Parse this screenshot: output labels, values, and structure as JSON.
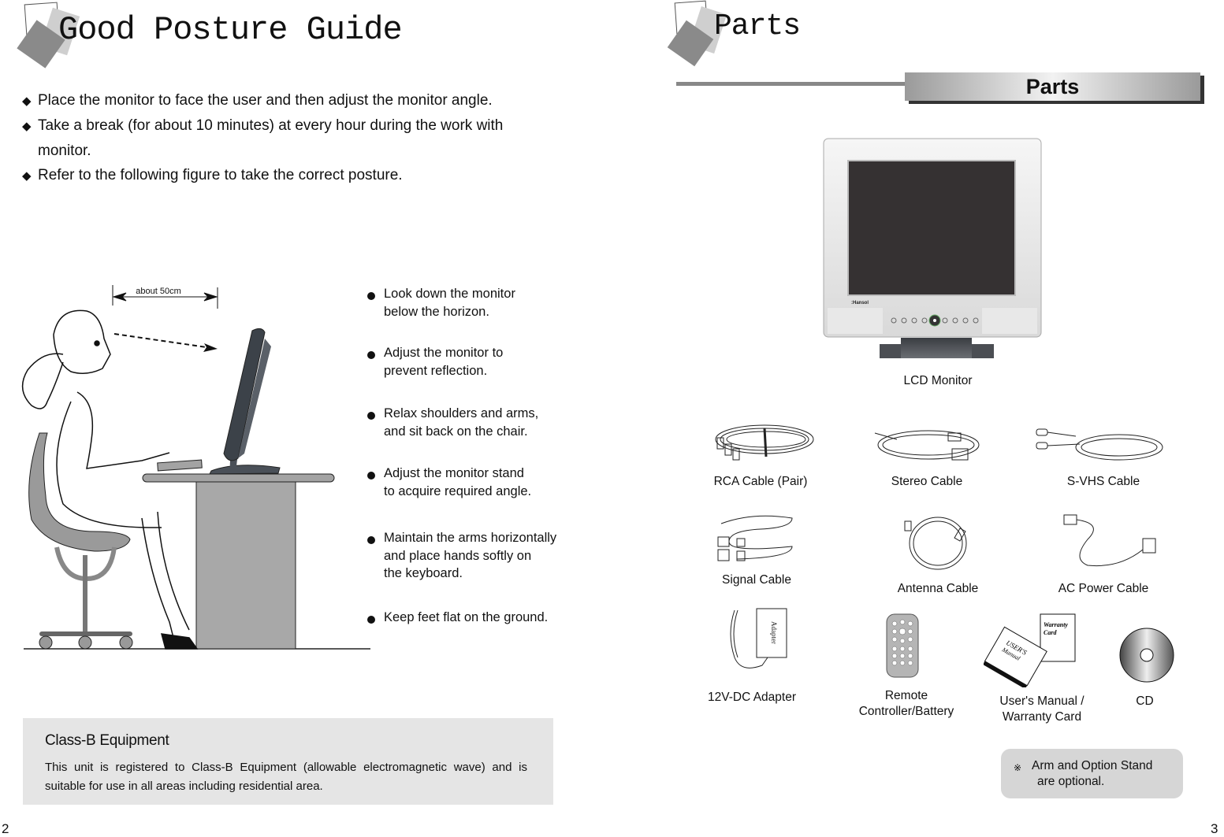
{
  "left_page": {
    "title": "Good Posture Guide",
    "bullets": [
      "Place the monitor to face the user and then adjust the monitor angle.",
      "Take a break (for about 10 minutes) at every hour during the work with",
      "monitor.",
      "Refer to the following figure to take the correct posture."
    ],
    "bullet_marker": "◆",
    "figure": {
      "distance_label": "about 50cm"
    },
    "tips": [
      [
        "Look down the monitor",
        "below the horizon."
      ],
      [
        "Adjust the monitor to",
        "prevent reflection."
      ],
      [
        "Relax shoulders and arms,",
        "and sit back on the chair."
      ],
      [
        "Adjust the monitor stand",
        "to acquire required angle."
      ],
      [
        "Maintain the arms horizontally",
        "and place hands softly on",
        "the keyboard."
      ],
      [
        "Keep feet flat on the ground."
      ]
    ],
    "class_b": {
      "heading": "Class-B Equipment",
      "body": "This unit is registered to Class-B Equipment (allowable electromagnetic wave) and is suitable for use in all areas including residential area."
    },
    "page_number": "2"
  },
  "right_page": {
    "title": "Parts",
    "section_bar": "Parts",
    "monitor": {
      "brand": ":Hansol",
      "label": "LCD Monitor"
    },
    "items": {
      "rca": "RCA Cable (Pair)",
      "stereo": "Stereo Cable",
      "svhs": "S-VHS Cable",
      "signal": "Signal Cable",
      "antenna": "Antenna Cable",
      "ac_power": "AC Power Cable",
      "adapter": "12V-DC Adapter",
      "adapter_text": "Adapter",
      "remote_line1": "Remote",
      "remote_line2": "Controller/Battery",
      "manual_line1": "User's Manual /",
      "manual_line2": "Warranty Card",
      "manual_cover_line1": "USER'S",
      "manual_cover_line2": "Manual",
      "warranty_line1": "Warranty",
      "warranty_line2": "Card",
      "cd": "CD"
    },
    "note": {
      "marker": "※",
      "line1": "Arm and Option Stand",
      "line2": "are optional."
    },
    "page_number": "3"
  }
}
